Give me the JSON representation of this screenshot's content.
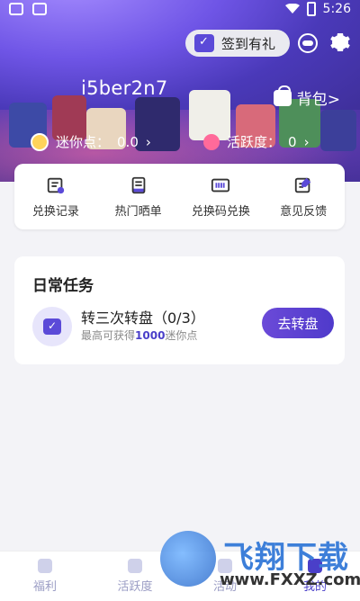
{
  "status_bar": {
    "time": "5:26"
  },
  "header": {
    "signin_label": "签到有礼",
    "username": "i5ber2n7",
    "backpack_label": "背包>",
    "mini_points_label": "迷你点：",
    "mini_points_value": "0.0",
    "activity_label": "活跃度：",
    "activity_value": "0"
  },
  "shortcuts": [
    {
      "label": "兑换记录",
      "icon": "record-icon"
    },
    {
      "label": "热门晒单",
      "icon": "hot-share-icon"
    },
    {
      "label": "兑换码兑换",
      "icon": "code-icon"
    },
    {
      "label": "意见反馈",
      "icon": "feedback-icon"
    }
  ],
  "daily_tasks": {
    "title": "日常任务",
    "task": {
      "title": "转三次转盘（0/3）",
      "sub_prefix": "最高可获得",
      "sub_amount": "1000",
      "sub_suffix": "迷你点",
      "button": "去转盘"
    }
  },
  "bottom_nav": [
    {
      "label": "福利"
    },
    {
      "label": "活跃度"
    },
    {
      "label": "活动"
    },
    {
      "label": "我的"
    }
  ],
  "watermark": {
    "brand": "飞翔下载",
    "url": "www.FXXZ.com"
  },
  "colors": {
    "accent": "#4a3fc9",
    "header": "#6f55e6"
  }
}
